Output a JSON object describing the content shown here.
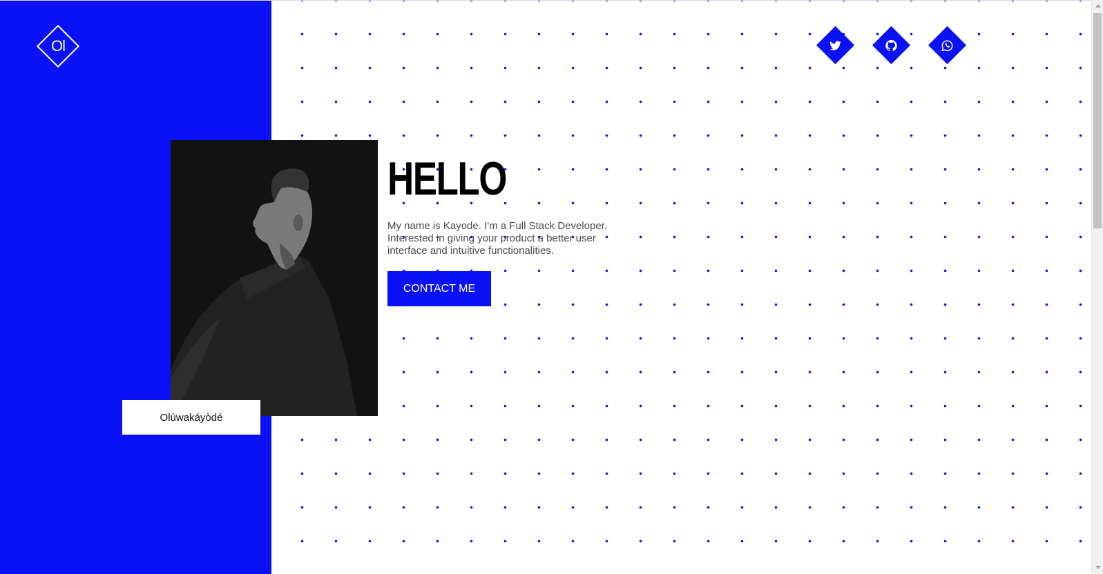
{
  "colors": {
    "accent": "#0a12f5",
    "background": "#ffffff",
    "heading": "#000000",
    "body_text": "#4a4a4a",
    "portrait_bg": "#121212"
  },
  "logo": {
    "text": "Ol",
    "icon": "diamond-logo-icon"
  },
  "portrait": {
    "icon": "man-silhouette-portrait"
  },
  "name_card": {
    "text": "Olúwakáyòdé"
  },
  "hero": {
    "heading": "HELLO",
    "intro": "My name is Kayode. I'm a Full Stack Developer. Interested in giving your product a better user interface and intuitive functionalities.",
    "contact_label": "CONTACT ME"
  },
  "social_links": [
    {
      "name": "twitter",
      "icon": "twitter-icon"
    },
    {
      "name": "github",
      "icon": "github-icon"
    },
    {
      "name": "whatsapp",
      "icon": "whatsapp-icon"
    }
  ],
  "scrollbar": {
    "position": 0
  }
}
